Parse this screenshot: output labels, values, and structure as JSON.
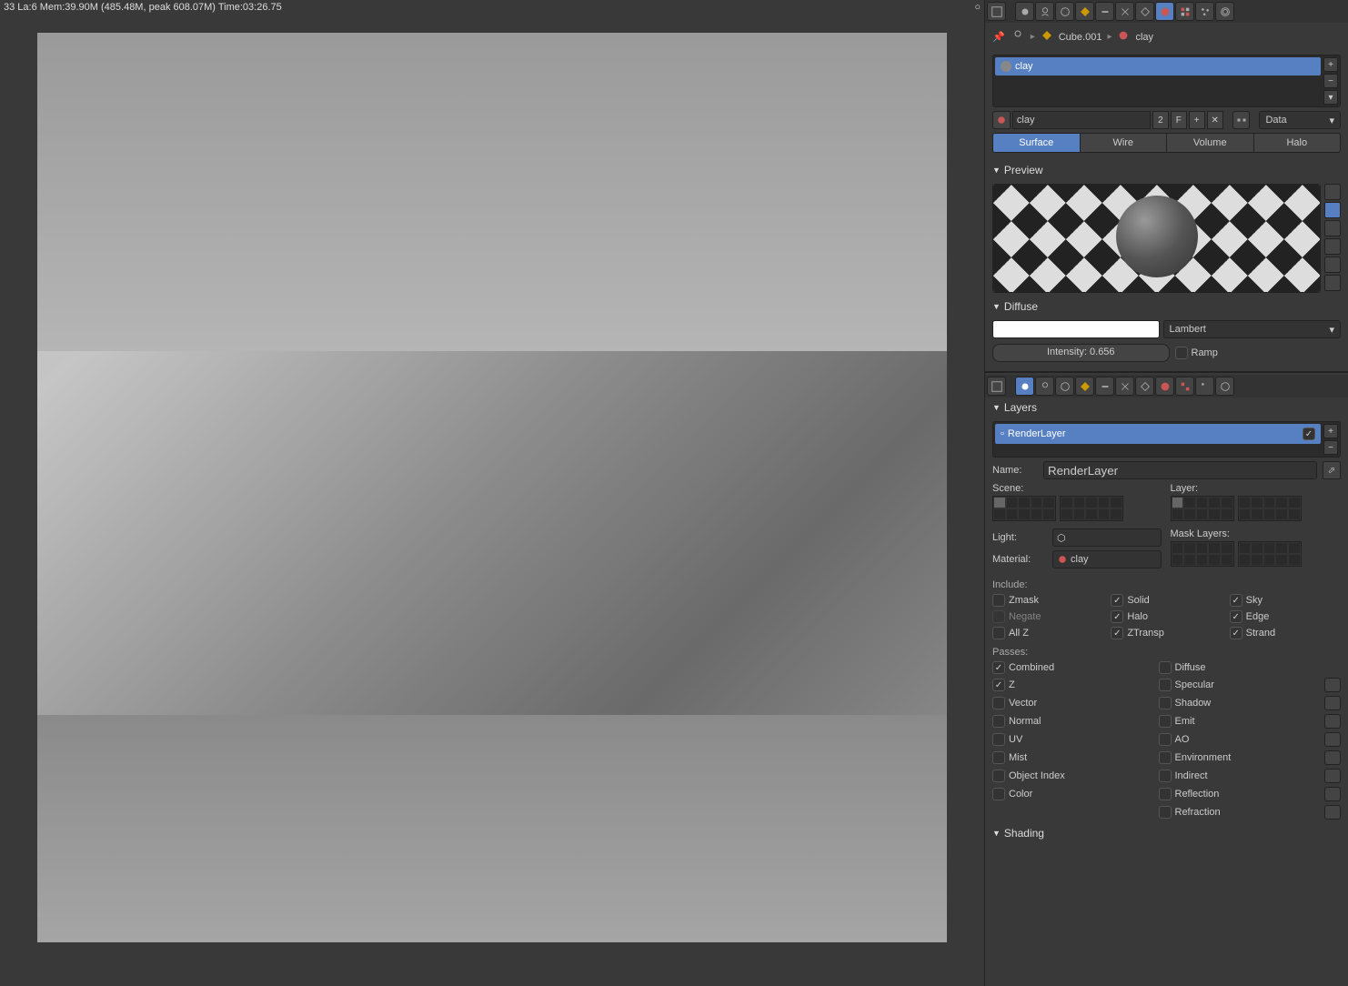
{
  "status": "33 La:6 Mem:39.90M (485.48M, peak 608.07M) Time:03:26.75",
  "breadcrumb": {
    "object": "Cube.001",
    "material": "clay"
  },
  "material": {
    "slot_name": "clay",
    "name": "clay",
    "users": "2",
    "fake": "F",
    "link": "Data",
    "type_tabs": [
      "Surface",
      "Wire",
      "Volume",
      "Halo"
    ]
  },
  "sections": {
    "preview": "Preview",
    "diffuse": "Diffuse",
    "layers": "Layers",
    "shading": "Shading"
  },
  "diffuse": {
    "model": "Lambert",
    "intensity": "Intensity: 0.656",
    "ramp": "Ramp"
  },
  "render_layer": {
    "name": "RenderLayer",
    "name_label": "Name:",
    "scene_label": "Scene:",
    "layer_label": "Layer:",
    "mask_label": "Mask Layers:",
    "light_label": "Light:",
    "material_label": "Material:",
    "material_value": "clay",
    "include_label": "Include:",
    "passes_label": "Passes:"
  },
  "include": {
    "zmask": "Zmask",
    "negate": "Negate",
    "allz": "All Z",
    "solid": "Solid",
    "halo": "Halo",
    "ztransp": "ZTransp",
    "sky": "Sky",
    "edge": "Edge",
    "strand": "Strand"
  },
  "passes": {
    "combined": "Combined",
    "z": "Z",
    "vector": "Vector",
    "normal": "Normal",
    "uv": "UV",
    "mist": "Mist",
    "object_index": "Object Index",
    "color": "Color",
    "diffuse": "Diffuse",
    "specular": "Specular",
    "shadow": "Shadow",
    "emit": "Emit",
    "ao": "AO",
    "environment": "Environment",
    "indirect": "Indirect",
    "reflection": "Reflection",
    "refraction": "Refraction"
  }
}
